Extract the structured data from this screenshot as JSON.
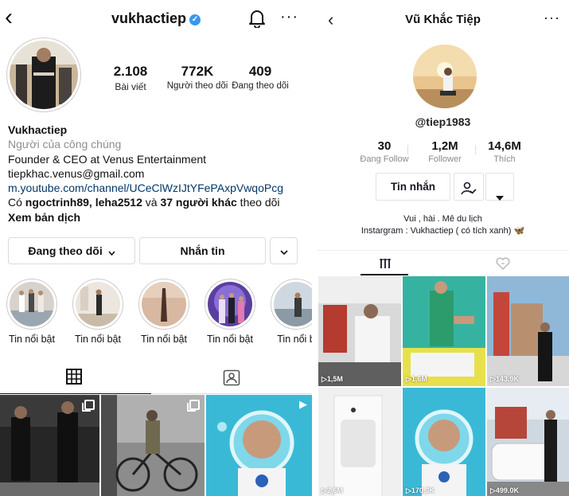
{
  "instagram": {
    "username": "vukhactiep",
    "verified_mark": "✓",
    "icons": [
      "back-arrow-icon",
      "verified-badge-icon",
      "bell-icon",
      "more-options-icon",
      "grid-icon",
      "tagged-icon"
    ],
    "stats": [
      {
        "number": "2.108",
        "label": "Bài viết"
      },
      {
        "number": "772K",
        "label": "Người theo dõi"
      },
      {
        "number": "409",
        "label": "Đang theo dõi"
      }
    ],
    "bio": {
      "name": "Vukhactiep",
      "category": "Người của công chúng",
      "line1": "Founder & CEO at Venus Entertainment",
      "email": "tiepkhac.venus@gmail.com",
      "link": "m.youtube.com/channel/UCeClWzIJtYFePAxpVwqoPcg",
      "followed_prefix": "Có ",
      "followed_names": "ngoctrinh89, leha2512",
      "followed_mid": " và ",
      "followed_others": "37 người khác",
      "followed_suffix": " theo dõi",
      "translate": "Xem bản dịch"
    },
    "buttons": {
      "following": "Đang theo dõi",
      "message": "Nhắn tin",
      "dropdown_icon": "chevron-down-icon"
    },
    "highlights": [
      {
        "label": "Tin nổi bật"
      },
      {
        "label": "Tin nổi bật"
      },
      {
        "label": "Tin nổi bật"
      },
      {
        "label": "Tin nổi bật"
      },
      {
        "label": "Tin nổi b"
      }
    ],
    "colors": {
      "verified": "#3897f0",
      "link": "#00376b",
      "muted": "#8e8e8e"
    }
  },
  "tiktok": {
    "title": "Vũ Khắc Tiệp",
    "handle": "@tiep1983",
    "stats": [
      {
        "number": "30",
        "label": "Đang Follow"
      },
      {
        "number": "1,2M",
        "label": "Follower"
      },
      {
        "number": "14,6M",
        "label": "Thích"
      }
    ],
    "buttons": {
      "message": "Tin nhắn",
      "follow_icon": "user-check-icon",
      "dropdown_icon": "caret-down-icon"
    },
    "bio_line1": "Vui , hài . Mê du lịch",
    "bio_line2": "Instargram : Vukhactiep ( có tích xanh) ",
    "bio_emoji": "🦋",
    "videos": [
      {
        "count": "1,5M"
      },
      {
        "count": "1,6M"
      },
      {
        "count": "143.9K"
      },
      {
        "count": "2,6M"
      },
      {
        "count": "170,3K"
      },
      {
        "count": "499.0K"
      }
    ]
  }
}
